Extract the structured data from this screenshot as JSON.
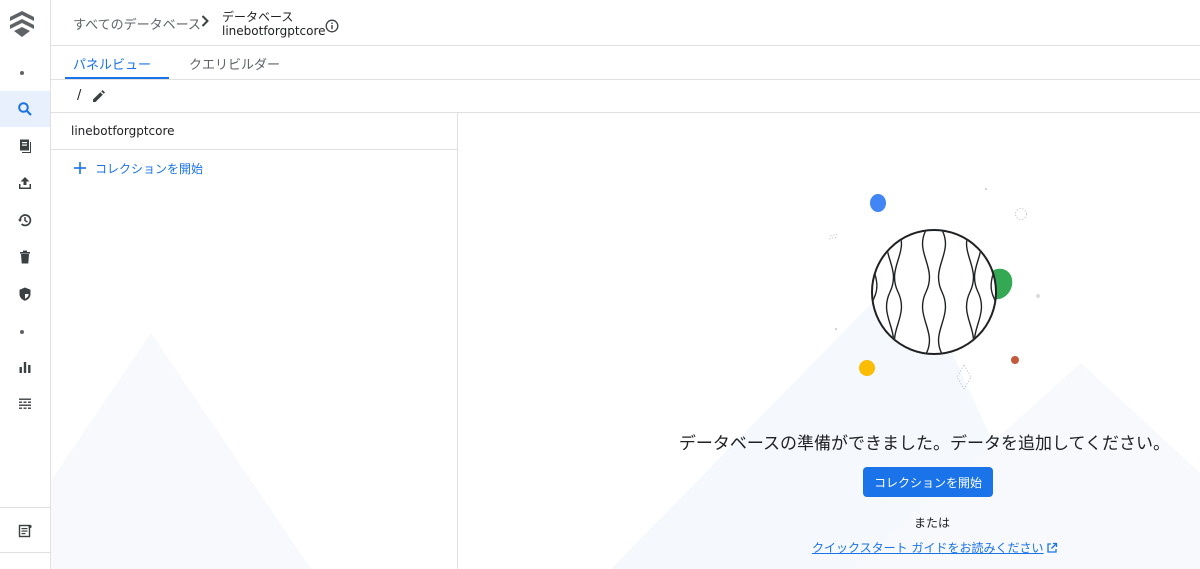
{
  "breadcrumb": {
    "root": "すべてのデータベース",
    "current_label": "データベース",
    "current_name": "linebotforgptcore"
  },
  "tabs": [
    {
      "label": "パネルビュー",
      "active": true
    },
    {
      "label": "クエリビルダー",
      "active": false
    }
  ],
  "path": "/",
  "panel": {
    "title": "linebotforgptcore",
    "start_collection": "コレクションを開始"
  },
  "empty_state": {
    "message": "データベースの準備ができました。データを追加してください。",
    "button": "コレクションを開始",
    "or": "または",
    "link": "クイックスタート ガイドをお読みください"
  },
  "rail": {
    "items": [
      "search-icon",
      "documents-icon",
      "import-export-icon",
      "history-icon",
      "delete-icon",
      "security-rules-icon",
      "usage-chart-icon",
      "indexes-icon",
      "release-notes-icon"
    ]
  },
  "colors": {
    "accent": "#1a73e8",
    "blob_blue": "#4285f4",
    "blob_green": "#34a853",
    "blob_yellow": "#fbbc04",
    "blob_red": "#c5593b"
  }
}
